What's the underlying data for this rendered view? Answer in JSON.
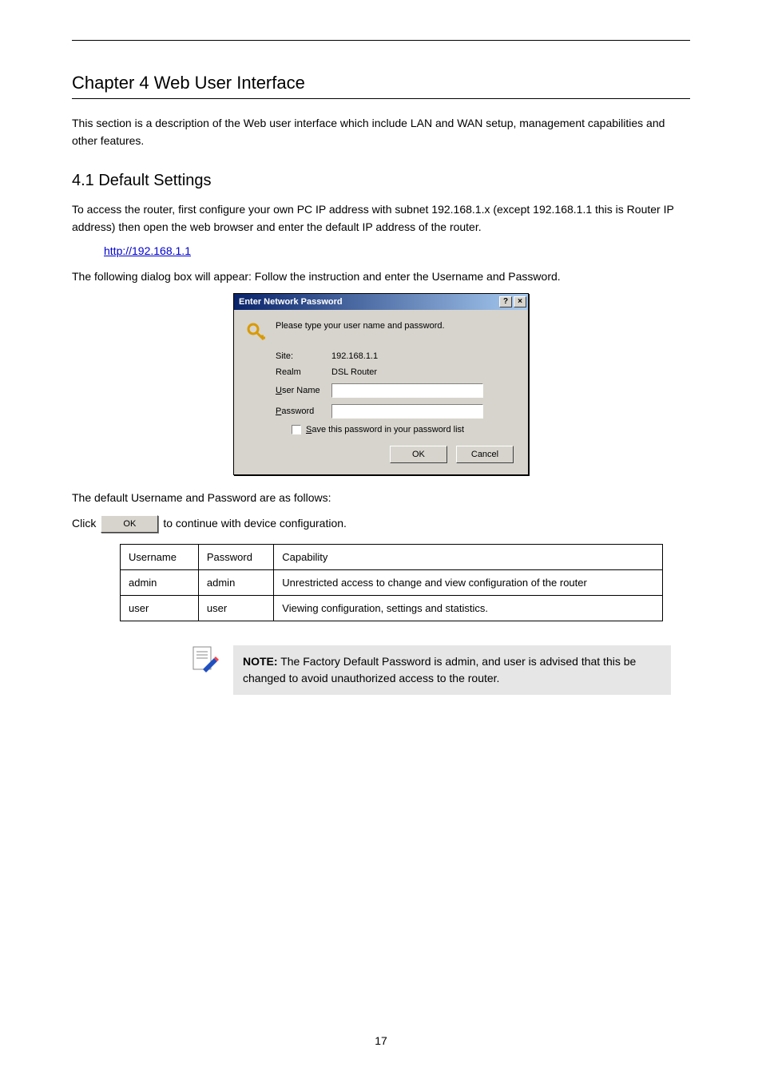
{
  "chapter": {
    "title": "Chapter 4 Web User Interface",
    "sub": "4.1 Default Settings",
    "intro": "This section is a description of the Web user interface which include LAN and WAN setup, management capabilities and other features.",
    "p1": "To access the router, first configure your own PC IP address with subnet 192.168.1.x (except 192.168.1.1 this is Router IP address) then open the web browser and enter the default IP address of the router.",
    "url": "http://192.168.1.1",
    "p2": "The following dialog box will appear: Follow the instruction and enter the Username and Password.",
    "p3_a": "Click",
    "p3_b": "to continue with device configuration."
  },
  "dialog": {
    "title": "Enter Network Password",
    "help": "?",
    "close": "×",
    "prompt": "Please type your user name and password.",
    "site_label": "Site:",
    "site_value": "192.168.1.1",
    "realm_label": "Realm",
    "realm_value": "DSL Router",
    "user_label": "User Name",
    "pass_label": "Password",
    "save_label": "Save this password in your password list",
    "ok": "OK",
    "cancel": "Cancel"
  },
  "accounts": {
    "headers": [
      "Username",
      "Password",
      "Capability"
    ],
    "rows": [
      [
        "admin",
        "admin",
        "Unrestricted access to change and view configuration of the router"
      ],
      [
        "user",
        "user",
        "Viewing configuration, settings and statistics."
      ]
    ]
  },
  "note": {
    "label": "NOTE:",
    "text": "The Factory Default Password is admin, and user is advised that this be changed to avoid unauthorized access to the router."
  },
  "page_number": "17"
}
